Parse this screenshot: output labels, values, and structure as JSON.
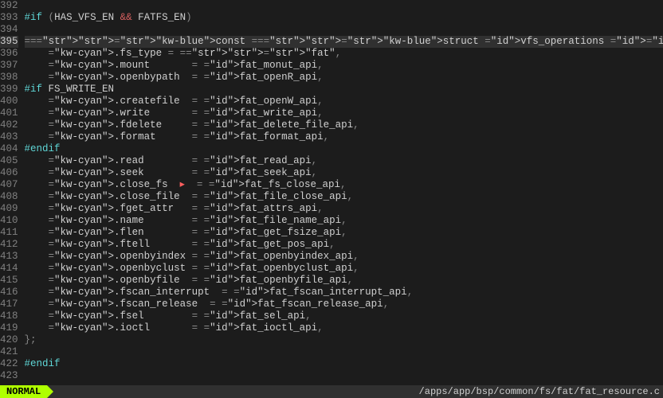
{
  "status": {
    "mode": "NORMAL",
    "branch_glyph": "",
    "path": "/apps/app/bsp/common/fs/fat/fat_resource.c"
  },
  "line_start": 392,
  "current_line": 395,
  "lines": [
    {
      "n": 392,
      "t": ""
    },
    {
      "n": 393,
      "t": "#if (HAS_VFS_EN && FATFS_EN)"
    },
    {
      "n": 394,
      "t": ""
    },
    {
      "n": 395,
      "t": "const struct vfs_operations fat_vfs_ops sec_used(.vfs_operations) = {"
    },
    {
      "n": 396,
      "t": "    .fs_type = \"fat\","
    },
    {
      "n": 397,
      "t": "    .mount       = fat_monut_api,"
    },
    {
      "n": 398,
      "t": "    .openbypath  = fat_openR_api,"
    },
    {
      "n": 399,
      "t": "#if FS_WRITE_EN"
    },
    {
      "n": 400,
      "t": "    .createfile  = fat_openW_api,"
    },
    {
      "n": 401,
      "t": "    .write       = fat_write_api,"
    },
    {
      "n": 402,
      "t": "    .fdelete     = fat_delete_file_api,"
    },
    {
      "n": 403,
      "t": "    .format      = fat_format_api,"
    },
    {
      "n": 404,
      "t": "#endif"
    },
    {
      "n": 405,
      "t": "    .read        = fat_read_api,"
    },
    {
      "n": 406,
      "t": "    .seek        = fat_seek_api,"
    },
    {
      "n": 407,
      "t": "    .close_fs  ▸  = fat_fs_close_api,"
    },
    {
      "n": 408,
      "t": "    .close_file  = fat_file_close_api,"
    },
    {
      "n": 409,
      "t": "    .fget_attr   = fat_attrs_api,"
    },
    {
      "n": 410,
      "t": "    .name        = fat_file_name_api,"
    },
    {
      "n": 411,
      "t": "    .flen        = fat_get_fsize_api,"
    },
    {
      "n": 412,
      "t": "    .ftell       = fat_get_pos_api,"
    },
    {
      "n": 413,
      "t": "    .openbyindex = fat_openbyindex_api,"
    },
    {
      "n": 414,
      "t": "    .openbyclust = fat_openbyclust_api,"
    },
    {
      "n": 415,
      "t": "    .openbyfile  = fat_openbyfile_api,"
    },
    {
      "n": 416,
      "t": "    .fscan_interrupt  = fat_fscan_interrupt_api,"
    },
    {
      "n": 417,
      "t": "    .fscan_release  = fat_fscan_release_api,"
    },
    {
      "n": 418,
      "t": "    .fsel        = fat_sel_api,"
    },
    {
      "n": 419,
      "t": "    .ioctl       = fat_ioctl_api,"
    },
    {
      "n": 420,
      "t": "};"
    },
    {
      "n": 421,
      "t": ""
    },
    {
      "n": 422,
      "t": "#endif"
    },
    {
      "n": 423,
      "t": ""
    }
  ]
}
